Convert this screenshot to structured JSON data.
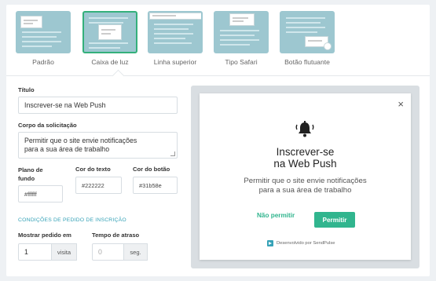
{
  "tabs": [
    {
      "label": "Padrão",
      "selected": false
    },
    {
      "label": "Caixa de luz",
      "selected": true
    },
    {
      "label": "Linha superior",
      "selected": false
    },
    {
      "label": "Tipo Safari",
      "selected": false
    },
    {
      "label": "Botão flutuante",
      "selected": false
    }
  ],
  "form": {
    "title_label": "Título",
    "title_value": "Inscrever-se na Web Push",
    "body_label": "Corpo da solicitação",
    "body_value_line1": "Permitir que o site envie notificações",
    "body_value_line2": "para a sua área de trabalho",
    "bg_label_line1": "Plano de",
    "bg_label_line2": "fundo",
    "bg_value": "#ffffff",
    "text_color_label": "Cor do texto",
    "text_color_value": "#222222",
    "button_color_label": "Cor do botão",
    "button_color_value": "#31b58e",
    "section_title": "CONDIÇÕES DE PEDIDO DE INSCRIÇÃO",
    "show_label": "Mostrar pedido em",
    "show_value": "1",
    "show_suffix": "visita",
    "delay_label": "Tempo de atraso",
    "delay_placeholder": "0",
    "delay_suffix": "seg."
  },
  "preview": {
    "close": "×",
    "title_line1": "Inscrever-se",
    "title_line2": "na Web Push",
    "body_line1": "Permitir que o site envie notificações",
    "body_line2": "para a sua área de trabalho",
    "deny": "Não permitir",
    "allow": "Permitir",
    "powered": "Desenvolvido por SendPulse"
  },
  "colors": {
    "accent": "#31b58e",
    "section": "#36a2b7",
    "selected_border": "#34b07b"
  }
}
